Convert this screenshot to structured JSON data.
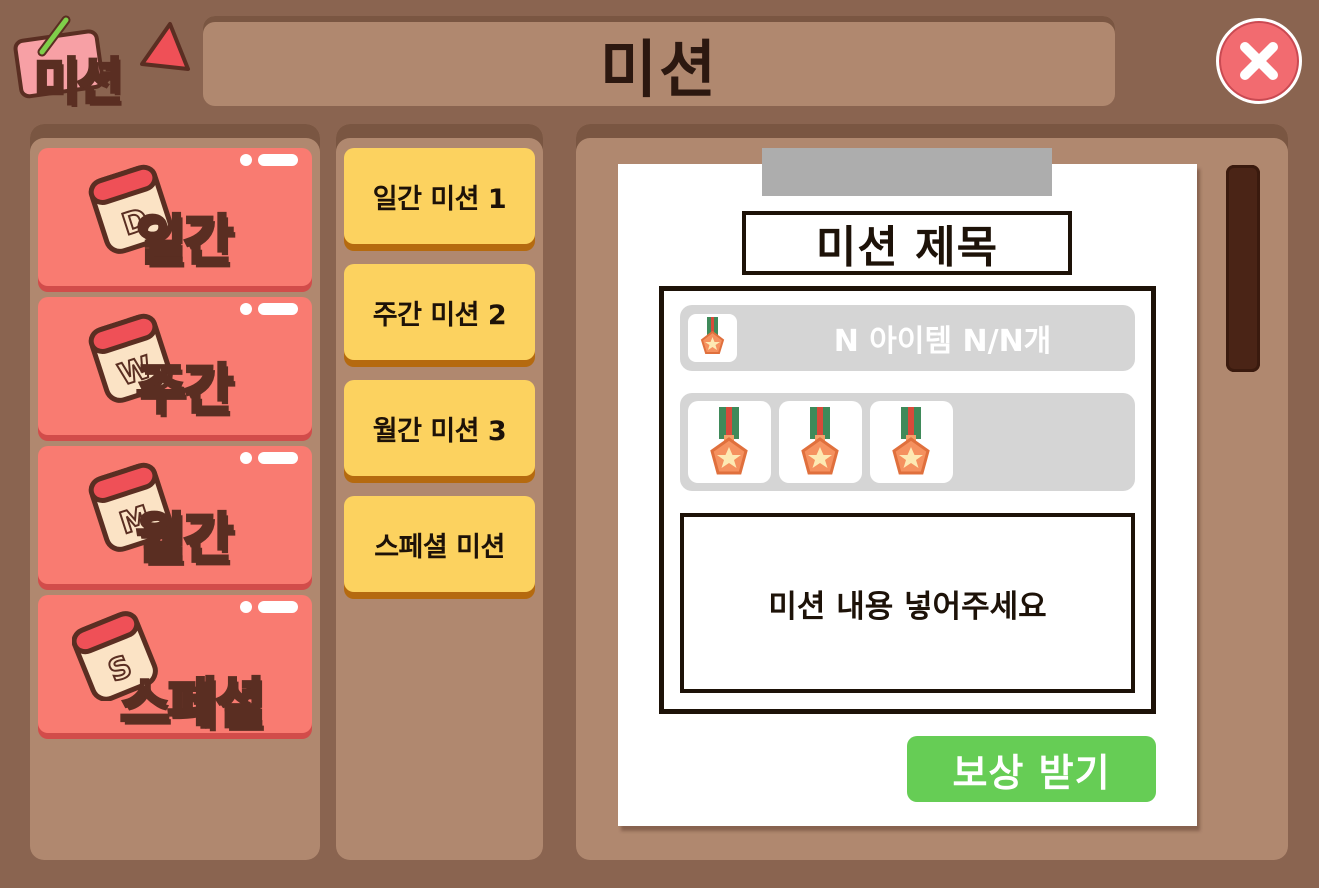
{
  "header": {
    "logo_text": "미션",
    "title": "미션",
    "close_icon": "close-x-icon"
  },
  "categories": [
    {
      "label": "일간",
      "badge": "D",
      "icon": "calendar-daily-icon"
    },
    {
      "label": "주간",
      "badge": "W",
      "icon": "calendar-weekly-icon"
    },
    {
      "label": "월간",
      "badge": "M",
      "icon": "calendar-monthly-icon"
    },
    {
      "label": "스페셜",
      "badge": "S",
      "icon": "calendar-special-icon"
    }
  ],
  "missions": [
    {
      "label": "일간 미션 1"
    },
    {
      "label": "주간 미션 2"
    },
    {
      "label": "월간 미션 3"
    },
    {
      "label": "스페셜 미션"
    }
  ],
  "detail": {
    "title": "미션 제목",
    "reward_text": "N 아이템 N/N개",
    "reward_icon": "medal-icon",
    "item_slots": [
      "medal-icon",
      "medal-icon",
      "medal-icon"
    ],
    "description": "미션 내용 넣어주세요",
    "claim_label": "보상 받기"
  },
  "colors": {
    "background": "#8a6450",
    "panel": "#b0886f",
    "category_button": "#f97b71",
    "mission_button": "#fcd25f",
    "claim_button": "#66cd55",
    "close_button": "#f26b70"
  }
}
